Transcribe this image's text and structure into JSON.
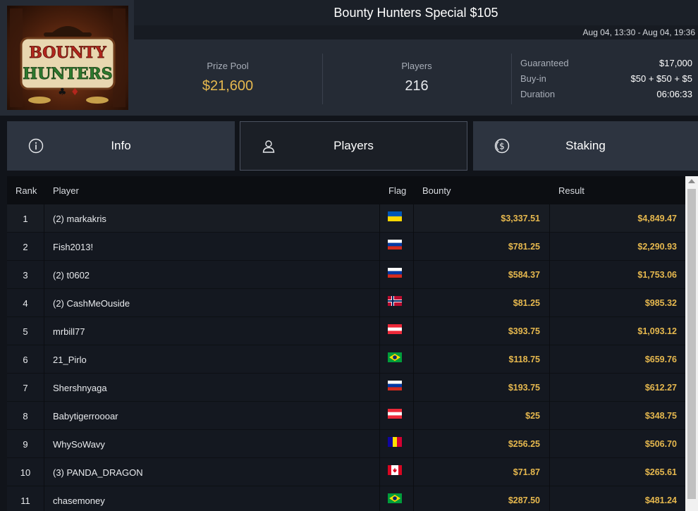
{
  "logo": {
    "line1": "BOUNTY",
    "line2": "HUNTERS"
  },
  "header": {
    "title": "Bounty Hunters Special $105",
    "dates": "Aug 04, 13:30 - Aug 04, 19:36"
  },
  "stats": {
    "prize_pool_label": "Prize Pool",
    "prize_pool": "$21,600",
    "players_label": "Players",
    "players": "216",
    "guaranteed_label": "Guaranteed",
    "guaranteed": "$17,000",
    "buyin_label": "Buy-in",
    "buyin": "$50 + $50 + $5",
    "duration_label": "Duration",
    "duration": "06:06:33"
  },
  "tabs": [
    {
      "label": "Info",
      "icon": "info-icon",
      "active": false
    },
    {
      "label": "Players",
      "icon": "user-icon",
      "active": true
    },
    {
      "label": "Staking",
      "icon": "dollar-coin-icon",
      "active": false
    }
  ],
  "table": {
    "headers": {
      "rank": "Rank",
      "player": "Player",
      "flag": "Flag",
      "bounty": "Bounty",
      "result": "Result"
    },
    "rows": [
      {
        "rank": "1",
        "player": "(2) markakris",
        "flag": "ukraine",
        "bounty": "$3,337.51",
        "result": "$4,849.47"
      },
      {
        "rank": "2",
        "player": "Fish2013!",
        "flag": "russia",
        "bounty": "$781.25",
        "result": "$2,290.93"
      },
      {
        "rank": "3",
        "player": "(2) t0602",
        "flag": "russia",
        "bounty": "$584.37",
        "result": "$1,753.06"
      },
      {
        "rank": "4",
        "player": "(2) CashMeOuside",
        "flag": "norway",
        "bounty": "$81.25",
        "result": "$985.32"
      },
      {
        "rank": "5",
        "player": "mrbill77",
        "flag": "austria",
        "bounty": "$393.75",
        "result": "$1,093.12"
      },
      {
        "rank": "6",
        "player": "21_Pirlo",
        "flag": "brazil",
        "bounty": "$118.75",
        "result": "$659.76"
      },
      {
        "rank": "7",
        "player": "Shershnyaga",
        "flag": "russia",
        "bounty": "$193.75",
        "result": "$612.27"
      },
      {
        "rank": "8",
        "player": "Babytigerroooar",
        "flag": "austria",
        "bounty": "$25",
        "result": "$348.75"
      },
      {
        "rank": "9",
        "player": "WhySoWavy",
        "flag": "andorra",
        "bounty": "$256.25",
        "result": "$506.70"
      },
      {
        "rank": "10",
        "player": "(3) PANDA_DRAGON",
        "flag": "canada",
        "bounty": "$71.87",
        "result": "$265.61"
      },
      {
        "rank": "11",
        "player": "chasemoney",
        "flag": "brazil",
        "bounty": "$287.50",
        "result": "$481.24"
      }
    ]
  },
  "colors": {
    "accent_gold": "#e6b84e",
    "panel": "#252b35",
    "tab": "#2d3440"
  }
}
